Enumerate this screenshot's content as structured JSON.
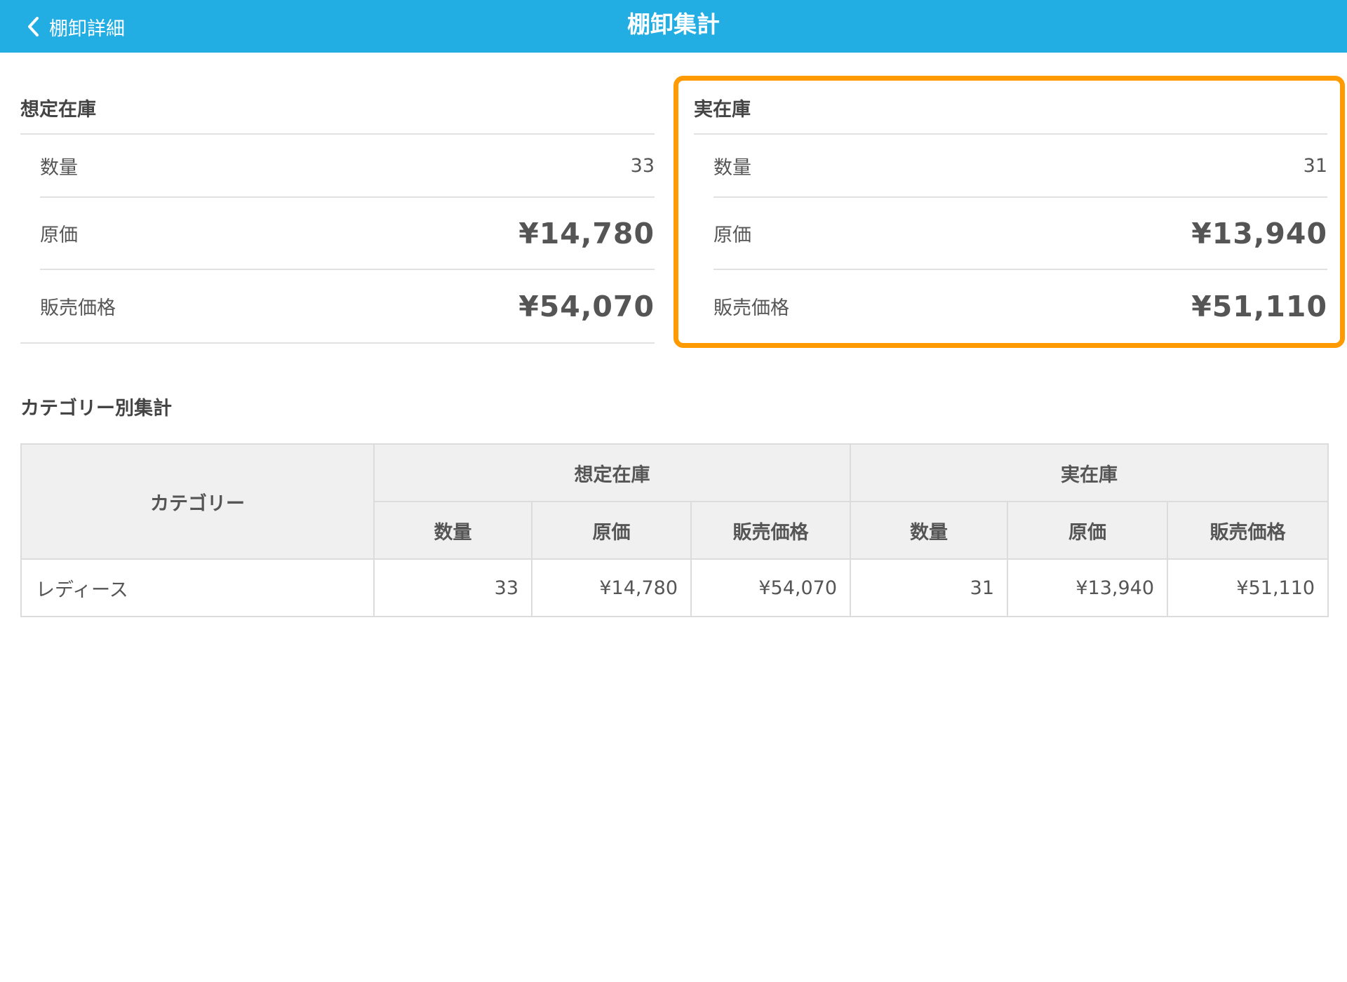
{
  "header": {
    "back_label": "棚卸詳細",
    "title": "棚卸集計"
  },
  "expected": {
    "title": "想定在庫",
    "quantity_label": "数量",
    "quantity": "33",
    "cost_label": "原価",
    "cost": "¥14,780",
    "price_label": "販売価格",
    "price": "¥54,070"
  },
  "actual": {
    "title": "実在庫",
    "quantity_label": "数量",
    "quantity": "31",
    "cost_label": "原価",
    "cost": "¥13,940",
    "price_label": "販売価格",
    "price": "¥51,110"
  },
  "category_section": {
    "title": "カテゴリー別集計",
    "category_header": "カテゴリー",
    "expected_header": "想定在庫",
    "actual_header": "実在庫",
    "sub_headers": {
      "quantity": "数量",
      "cost": "原価",
      "price": "販売価格"
    },
    "rows": [
      {
        "category": "レディース",
        "expected_quantity": "33",
        "expected_cost": "¥14,780",
        "expected_price": "¥54,070",
        "actual_quantity": "31",
        "actual_cost": "¥13,940",
        "actual_price": "¥51,110"
      }
    ]
  },
  "colors": {
    "header_bg": "#22ade3",
    "highlight": "#ff9a00",
    "table_header_bg": "#f0f0f0"
  }
}
